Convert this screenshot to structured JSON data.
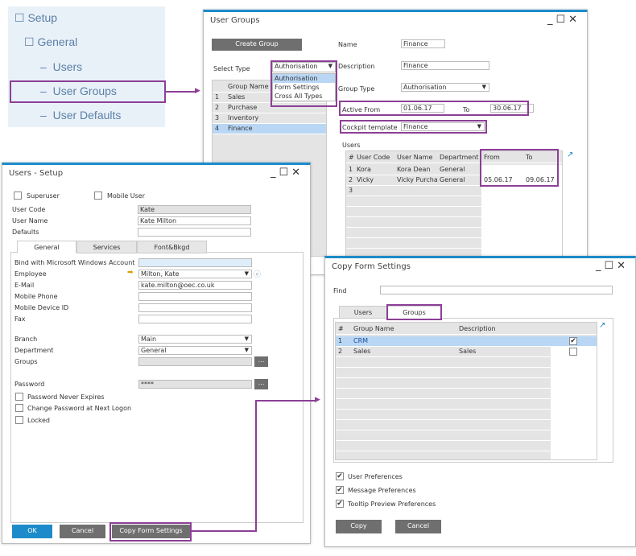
{
  "nav": {
    "items": [
      "Setup",
      "General",
      "Users",
      "User Groups",
      "User Defaults"
    ]
  },
  "user_groups": {
    "title": "User Groups",
    "create": "Create Group",
    "select_type_label": "Select Type",
    "select_type": "Authorisation",
    "options": [
      "Authorisation",
      "Form Settings",
      "Cross All Types"
    ],
    "grid_header": "Group Name",
    "groups": [
      {
        "n": "1",
        "name": "Sales"
      },
      {
        "n": "2",
        "name": "Purchase"
      },
      {
        "n": "3",
        "name": "Inventory"
      },
      {
        "n": "4",
        "name": "Finance"
      }
    ],
    "name_label": "Name",
    "name": "Finance",
    "desc_label": "Description",
    "desc": "Finance",
    "type_label": "Group Type",
    "type": "Authorisation",
    "from_label": "Active From",
    "from": "01.06.17",
    "to_label": "To",
    "to": "30.06.17",
    "cockpit_label": "Cockpit template",
    "cockpit": "Finance",
    "users_label": "Users",
    "users_headers": [
      "#",
      "User Code",
      "User Name",
      "Department",
      "From",
      "To"
    ],
    "users": [
      [
        "1",
        "Kora",
        "Kora Dean",
        "General",
        "",
        ""
      ],
      [
        "2",
        "Vicky",
        "Vicky Purchas",
        "General",
        "05.06.17",
        "09.06.17"
      ],
      [
        "3",
        "",
        "",
        "",
        "",
        ""
      ]
    ]
  },
  "users_setup": {
    "title": "Users - Setup",
    "superuser": "Superuser",
    "mobile_user": "Mobile User",
    "code_label": "User Code",
    "code": "Kate",
    "uname_label": "User Name",
    "uname": "Kate Milton",
    "defaults_label": "Defaults",
    "tabs": [
      "General",
      "Services",
      "Font&Bkgd"
    ],
    "fields": [
      {
        "l": "Bind with Microsoft Windows Account",
        "v": ""
      },
      {
        "l": "Employee",
        "v": "Milton, Kate"
      },
      {
        "l": "E-Mail",
        "v": "kate.milton@oec.co.uk"
      },
      {
        "l": "Mobile Phone",
        "v": ""
      },
      {
        "l": "Mobile Device ID",
        "v": ""
      },
      {
        "l": "Fax",
        "v": ""
      }
    ],
    "branch_label": "Branch",
    "branch": "Main",
    "dept_label": "Department",
    "dept": "General",
    "groups_label": "Groups",
    "pw_label": "Password",
    "pw": "****",
    "ellipsis": "...",
    "checks": [
      "Password Never Expires",
      "Change Password at Next Logon",
      "Locked"
    ],
    "ok": "OK",
    "cancel": "Cancel",
    "copy": "Copy Form Settings"
  },
  "copy_form": {
    "title": "Copy Form Settings",
    "find_label": "Find",
    "tabs": [
      "Users",
      "Groups"
    ],
    "headers": [
      "#",
      "Group Name",
      "Description"
    ],
    "rows": [
      {
        "n": "1",
        "name": "CRM",
        "desc": "",
        "checked": true
      },
      {
        "n": "2",
        "name": "Sales",
        "desc": "Sales",
        "checked": false
      }
    ],
    "checks": [
      "User Preferences",
      "Message Preferences",
      "Tooltip Preview Preferences"
    ],
    "copy": "Copy",
    "cancel": "Cancel"
  },
  "colors": {
    "accent": "#1d8bc9",
    "highlight": "#8c3f96",
    "selected": "#b9d7f5"
  }
}
